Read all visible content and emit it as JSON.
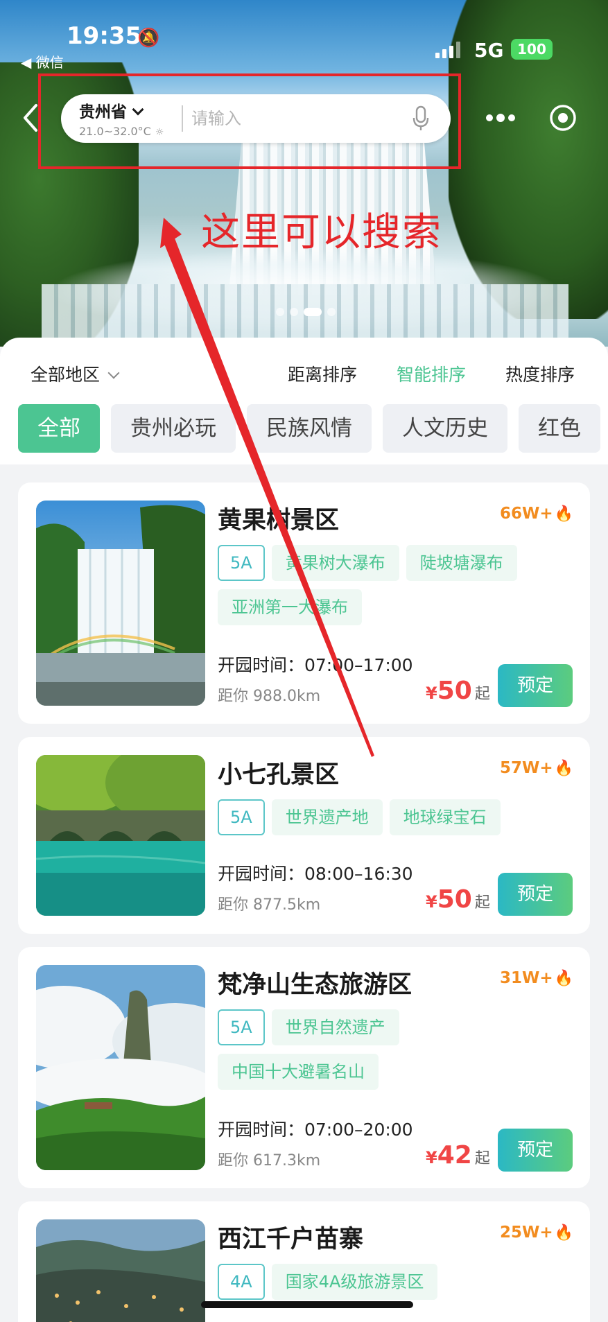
{
  "status_bar": {
    "time": "19:35",
    "back_app": "微信",
    "network": "5G",
    "battery": "100"
  },
  "search": {
    "location": "贵州省",
    "temperature": "21.0~32.0°C",
    "placeholder": "请输入"
  },
  "annotation": {
    "text": "这里可以搜索",
    "color": "#e5262a"
  },
  "banner": {
    "dot_count": 4,
    "active_dot": 2
  },
  "filters": {
    "region": "全部地区",
    "sorts": [
      "距离排序",
      "智能排序",
      "热度排序"
    ],
    "active_sort": 1,
    "categories": [
      "全部",
      "贵州必玩",
      "民族风情",
      "人文历史",
      "红色"
    ],
    "active_category": 0
  },
  "colors": {
    "accent": "#4cc592",
    "price": "#f04545",
    "hot": "#f28c1f"
  },
  "attractions": [
    {
      "name": "黄果树景区",
      "hot": "66W+",
      "tags": [
        "5A",
        "黄果树大瀑布",
        "陡坡塘瀑布",
        "亚洲第一大瀑布"
      ],
      "hours": "开园时间：07:00–17:00",
      "distance": "距你 988.0km",
      "price_symbol": "¥",
      "price": "50",
      "price_suffix": "起",
      "book_label": "预定",
      "image": "waterfall-photo"
    },
    {
      "name": "小七孔景区",
      "hot": "57W+",
      "tags": [
        "5A",
        "世界遗产地",
        "地球绿宝石"
      ],
      "hours": "开园时间：08:00–16:30",
      "distance": "距你 877.5km",
      "price_symbol": "¥",
      "price": "50",
      "price_suffix": "起",
      "book_label": "预定",
      "image": "bridge-river-photo"
    },
    {
      "name": "梵净山生态旅游区",
      "hot": "31W+",
      "tags": [
        "5A",
        "世界自然遗产",
        "中国十大避暑名山"
      ],
      "hours": "开园时间：07:00–20:00",
      "distance": "距你 617.3km",
      "price_symbol": "¥",
      "price": "42",
      "price_suffix": "起",
      "book_label": "预定",
      "image": "mountain-clouds-photo"
    },
    {
      "name": "西江千户苗寨",
      "hot": "25W+",
      "tags": [
        "4A",
        "国家4A级旅游景区"
      ],
      "image": "village-photo"
    }
  ]
}
